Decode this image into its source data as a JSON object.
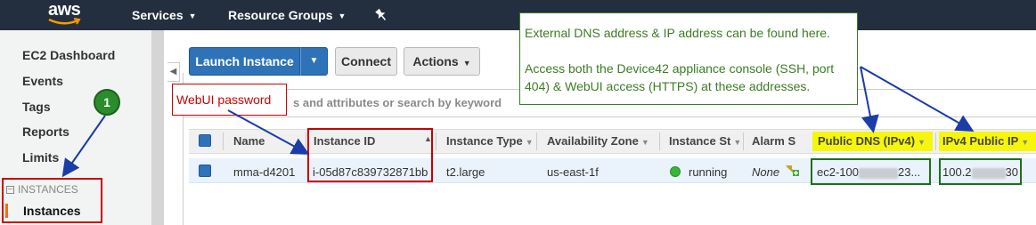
{
  "topnav": {
    "logo": "aws",
    "services": "Services",
    "resource_groups": "Resource Groups"
  },
  "sidebar": {
    "items": [
      "EC2 Dashboard",
      "Events",
      "Tags",
      "Reports",
      "Limits"
    ],
    "section_header": "INSTANCES",
    "active_item": "Instances"
  },
  "toolbar": {
    "launch_label": "Launch Instance",
    "connect_label": "Connect",
    "actions_label": "Actions"
  },
  "search": {
    "placeholder_visible": "s and attributes or search by keyword"
  },
  "table": {
    "headers": [
      "Name",
      "Instance ID",
      "Instance Type",
      "Availability Zone",
      "Instance St",
      "Alarm S",
      "Public DNS (IPv4)",
      "IPv4 Public IP"
    ],
    "row": {
      "name": "mma-d4201",
      "instance_id": "i-05d87c839732871bb",
      "instance_type": "t2.large",
      "availability_zone": "us-east-1f",
      "state": "running",
      "alarm": "None",
      "dns_prefix": "ec2-100",
      "dns_suffix": "23...",
      "ip_prefix": "100.2",
      "ip_suffix": "30"
    }
  },
  "annotations": {
    "callout_line1": "External DNS address & IP address can be found here.",
    "callout_line2": "Access both the Device42 appliance console (SSH, port 404) & WebUI access (HTTPS) at these addresses.",
    "webui_label": "WebUI password",
    "step_number": "1"
  },
  "colors": {
    "nav_bg": "#232f3e",
    "primary_button": "#2e73b8",
    "annotation_red": "#cc0000",
    "annotation_green": "#3b7d23",
    "highlight_yellow": "#f6f60a",
    "running": "#37b837"
  }
}
